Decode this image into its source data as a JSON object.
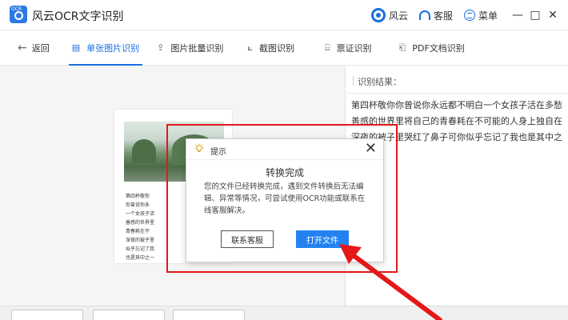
{
  "app": {
    "title": "风云OCR文字识别",
    "logo_tag": "OCR"
  },
  "titlebar": {
    "fengyun_label": "风云",
    "kefu_label": "客服",
    "menu_label": "菜单",
    "min_glyph": "—",
    "max_glyph": "□",
    "close_glyph": "✕"
  },
  "toolbar": {
    "back_label": "返回",
    "tabs": [
      {
        "label": "单张图片识别",
        "icon": "image-doc-icon",
        "active": true
      },
      {
        "label": "图片批量识别",
        "icon": "upload-icon",
        "active": false
      },
      {
        "label": "截图识别",
        "icon": "crop-icon",
        "active": false
      },
      {
        "label": "票证识别",
        "icon": "scan-icon",
        "active": false
      },
      {
        "label": "PDF文档识别",
        "icon": "pdf-icon",
        "active": false
      }
    ]
  },
  "result": {
    "heading": "识别结果：",
    "lines": [
      "第四杯敬你你曾说你永远都不明白一个女孩子活在多愁",
      "善感的世界里将自己的青春耗在不可能的人身上独自在",
      "深夜的被子里哭红了鼻子可你似乎忘记了我也是其中之"
    ]
  },
  "preview": {
    "lines": [
      "第四杯敬你",
      "你曾说你永",
      "一个女孩子活",
      "善感的世界里",
      "青春耗在不",
      "深夜的被子里",
      "似乎忘记了我",
      "也是其中之一"
    ]
  },
  "dialog": {
    "title": "提示",
    "close_glyph": "✕",
    "heading": "转换完成",
    "body_lines": [
      "您的文件已经转换完成，遇到文件转换后无法编",
      "辑、异常等情况，可尝试使用OCR功能或联系在",
      "线客服解决。"
    ],
    "contact_label": "联系客服",
    "open_label": "打开文件"
  },
  "colors": {
    "accent": "#1a6fe0",
    "primary_button": "#2382f0",
    "highlight": "#e41818"
  }
}
